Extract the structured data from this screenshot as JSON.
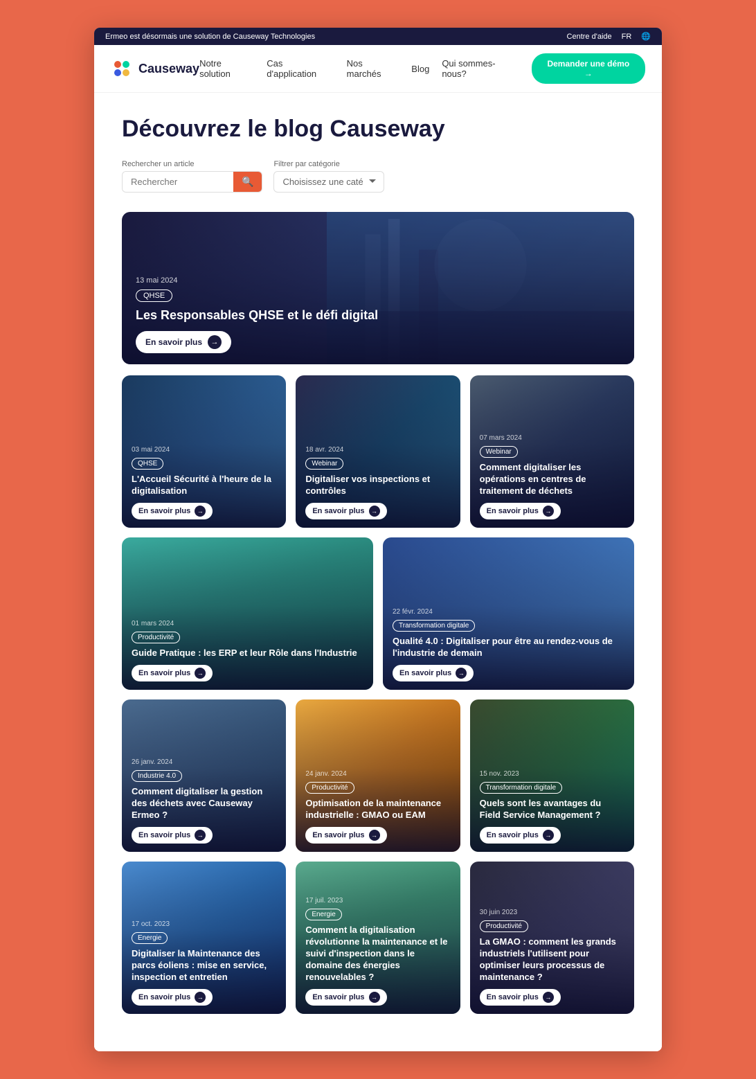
{
  "topbar": {
    "announcement": "Ermeo est désormais une solution de Causeway Technologies",
    "help_center": "Centre d'aide",
    "lang": "FR"
  },
  "nav": {
    "logo_text": "Causeway",
    "links": [
      "Notre solution",
      "Cas d'application",
      "Nos marchés",
      "Blog",
      "Qui sommes-nous?"
    ],
    "cta": "Demander une démo →"
  },
  "page": {
    "title": "Découvrez le blog Causeway"
  },
  "search": {
    "label": "Rechercher un article",
    "placeholder": "Rechercher"
  },
  "filter": {
    "label": "Filtrer par catégorie",
    "placeholder": "Choisissez une catégorie"
  },
  "featured": {
    "date": "13 mai 2024",
    "tag": "QHSE",
    "title": "Les Responsables QHSE et le défi digital",
    "cta": "En savoir plus"
  },
  "articles": [
    {
      "date": "03 mai 2024",
      "tag": "QHSE",
      "title": "L'Accueil Sécurité à l'heure de la digitalisation",
      "cta": "En savoir plus",
      "bg": "bg-blue-workers"
    },
    {
      "date": "18 avr. 2024",
      "tag": "Webinar",
      "title": "Digitaliser vos inspections et contrôles",
      "cta": "En savoir plus",
      "bg": "bg-industrial"
    },
    {
      "date": "07 mars 2024",
      "tag": "Webinar",
      "title": "Comment digitaliser les opérations en centres de traitement de déchets",
      "cta": "En savoir plus",
      "bg": "bg-smoke"
    },
    {
      "date": "01 mars 2024",
      "tag": "Productivité",
      "title": "Guide Pratique : les ERP et leur Rôle dans l'Industrie",
      "cta": "En savoir plus",
      "bg": "bg-erp",
      "wide": false
    },
    {
      "date": "22 févr. 2024",
      "tag": "Transformation digitale",
      "title": "Qualité 4.0 : Digitaliser pour être au rendez-vous de l'industrie de demain",
      "cta": "En savoir plus",
      "bg": "bg-industry4",
      "wide": true
    },
    {
      "date": "26 janv. 2024",
      "tag": "Industrie 4.0",
      "title": "Comment digitaliser la gestion des déchets avec Causeway Ermeo ?",
      "cta": "En savoir plus",
      "bg": "bg-waste"
    },
    {
      "date": "24 janv. 2024",
      "tag": "Productivité",
      "title": "Optimisation de la maintenance industrielle : GMAO ou EAM",
      "cta": "En savoir plus",
      "bg": "bg-energy-opt"
    },
    {
      "date": "15 nov. 2023",
      "tag": "Transformation digitale",
      "title": "Quels sont les avantages du Field Service Management ?",
      "cta": "En savoir plus",
      "bg": "bg-field-service"
    },
    {
      "date": "17 oct. 2023",
      "tag": "Energie",
      "title": "Digitaliser la Maintenance des parcs éoliens : mise en service, inspection et entretien",
      "cta": "En savoir plus",
      "bg": "bg-wind1"
    },
    {
      "date": "17 juil. 2023",
      "tag": "Energie",
      "title": "Comment la digitalisation révolutionne la maintenance et le suivi d'inspection dans le domaine des énergies renouvelables ?",
      "cta": "En savoir plus",
      "bg": "bg-wind2"
    },
    {
      "date": "30 juin 2023",
      "tag": "Productivité",
      "title": "La GMAO : comment les grands industriels l'utilisent pour optimiser leurs processus de maintenance ?",
      "cta": "En savoir plus",
      "bg": "bg-industrial2"
    }
  ]
}
